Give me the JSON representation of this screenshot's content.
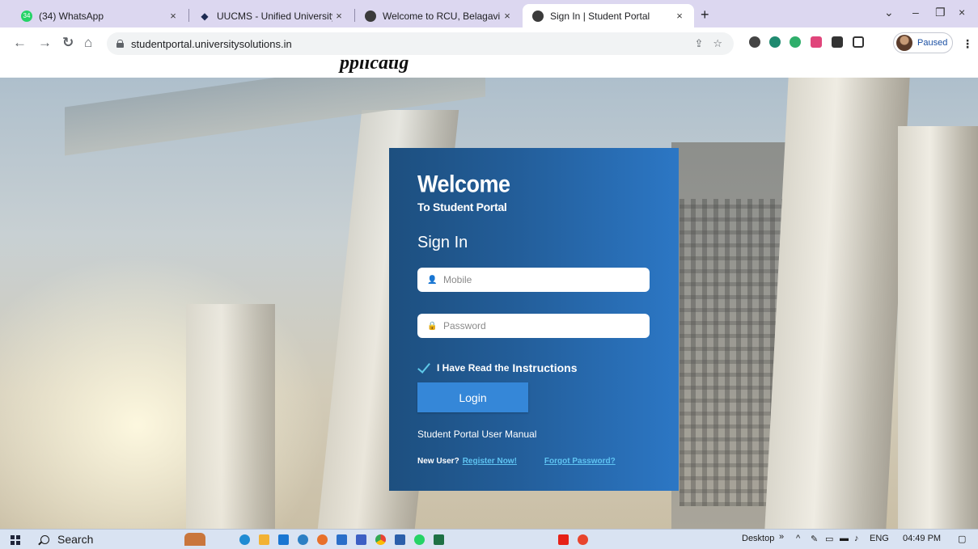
{
  "browser": {
    "tabs": [
      {
        "title": "(34) WhatsApp",
        "badge": "34",
        "active": false
      },
      {
        "title": "UUCMS - Unified University Colle",
        "active": false
      },
      {
        "title": "Welcome to RCU, Belagavi",
        "active": false
      },
      {
        "title": "Sign In | Student Portal",
        "active": true
      }
    ],
    "close_glyph": "×",
    "new_tab_glyph": "+",
    "url": "studentportal.universitysolutions.in",
    "profile_status": "Paused"
  },
  "page_caption": "pplicatig",
  "login": {
    "title": "Welcome",
    "subtitle": "To Student Portal",
    "heading": "Sign In",
    "mobile_placeholder": "Mobile",
    "password_placeholder": "Password",
    "agree_prefix": "I Have Read the",
    "agree_link": "Instructions",
    "login_button": "Login",
    "manual_link": "Student Portal User Manual",
    "new_user_label": "New User?",
    "register_link": "Register Now!",
    "forgot_link": "Forgot Password?"
  },
  "taskbar": {
    "search_label": "Search",
    "desktop_label": "Desktop",
    "language": "ENG",
    "time": "04:49 PM"
  },
  "colors": {
    "card_start": "#1d4f7f",
    "card_end": "#2c77c5",
    "button": "#3587d8",
    "link": "#5fc4f2"
  }
}
